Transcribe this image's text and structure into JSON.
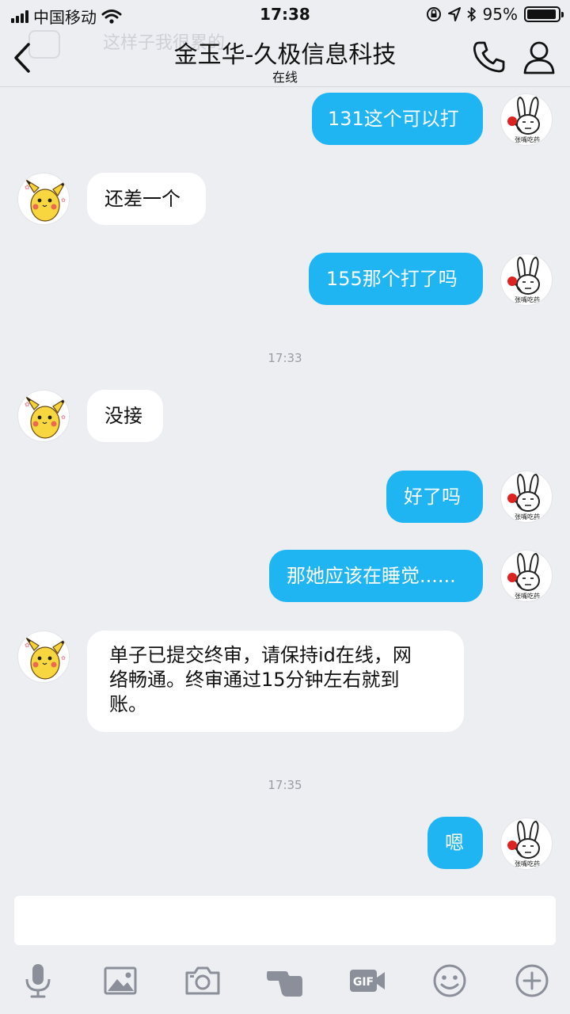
{
  "status": {
    "carrier": "中国移动",
    "time": "17:38",
    "battery": "95%",
    "battery_level": 0.95
  },
  "nav": {
    "ghost_text": "这样子我很累的",
    "title": "金玉华-久极信息科技",
    "subtitle": "在线",
    "icons": [
      "back-icon",
      "phone-icon",
      "contact-icon"
    ]
  },
  "messages": [
    {
      "from": "me",
      "text": "131这个可以打"
    },
    {
      "from": "them",
      "text": "还差一个"
    },
    {
      "from": "me",
      "text": "155那个打了吗"
    },
    {
      "type": "time",
      "text": "17:33"
    },
    {
      "from": "them",
      "text": "没接"
    },
    {
      "from": "me",
      "text": "好了吗"
    },
    {
      "from": "me",
      "text": "那她应该在睡觉......"
    },
    {
      "from": "them",
      "lines": [
        "单子已提交终审，请保持id在线，网",
        "络畅通。终审通过15分钟左右就到",
        "账。"
      ]
    },
    {
      "type": "time",
      "text": "17:35"
    },
    {
      "from": "me",
      "text": "嗯"
    }
  ],
  "my_avatar_caption": "张嘴吃药",
  "input": {
    "value": ""
  },
  "toolbar": {
    "icons": [
      "microphone-icon",
      "image-icon",
      "camera-icon",
      "poke-hand-icon",
      "gif-icon",
      "emoji-icon",
      "plus-icon"
    ],
    "gif_label": "GIF"
  },
  "colors": {
    "background": "#edeef2",
    "outgoing_bubble": "#1fb4f2",
    "incoming_bubble": "#ffffff",
    "icon_gray": "#8a8f99"
  }
}
